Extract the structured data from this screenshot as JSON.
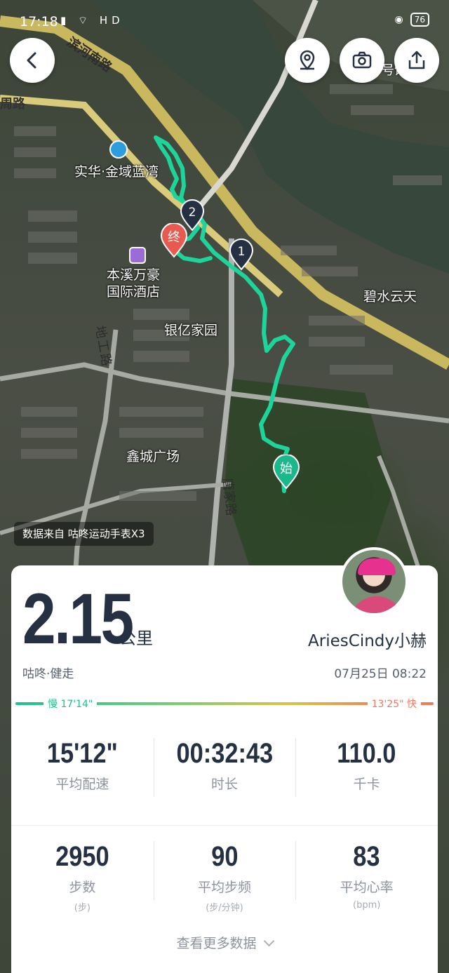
{
  "status_bar": {
    "time": "17:18",
    "signal": "46",
    "net": "HD",
    "battery": "76"
  },
  "map": {
    "labels": {
      "road_binhe_south": "滨河南路",
      "road_left_top": "周路",
      "poi_shihua": "实华·金域蓝湾",
      "poi_hotel": "本溪万豪\n国际酒店",
      "area_yinyi": "银亿家园",
      "area_bishui": "碧水云天",
      "road_digong": "地工路",
      "area_xincheng": "鑫城广场",
      "road_tangjia": "唐家路",
      "poi_top_right": "号馆"
    },
    "markers": {
      "start": "始",
      "end": "终",
      "km1": "1",
      "km2": "2"
    },
    "data_source": "数据来自 咕咚运动手表X3"
  },
  "summary": {
    "distance": "2.15",
    "distance_unit": "公里",
    "username": "AriesCindy小赫",
    "activity_type": "咕咚·健走",
    "datetime": "07月25日 08:22",
    "pace_slow": "慢 17'14\"",
    "pace_fast": "13'25\" 快"
  },
  "stats": [
    {
      "value": "15'12\"",
      "label": "平均配速",
      "unit": ""
    },
    {
      "value": "00:32:43",
      "label": "时长",
      "unit": ""
    },
    {
      "value": "110.0",
      "label": "千卡",
      "unit": ""
    },
    {
      "value": "2950",
      "label": "步数",
      "unit": "(步)"
    },
    {
      "value": "90",
      "label": "平均步频",
      "unit": "(步/分钟)"
    },
    {
      "value": "83",
      "label": "平均心率",
      "unit": "(bpm)"
    }
  ],
  "more_label": "查看更多数据",
  "icons": [
    "back-icon",
    "location-pin-icon",
    "camera-icon",
    "share-icon",
    "chevron-down-icon",
    "hotel-icon",
    "building-icon"
  ],
  "colors": {
    "route": "#1dd59a",
    "end_pin": "#e85a50",
    "start_pin": "#1bb88c",
    "km_marker": "#253143",
    "text_dark": "#253143"
  }
}
